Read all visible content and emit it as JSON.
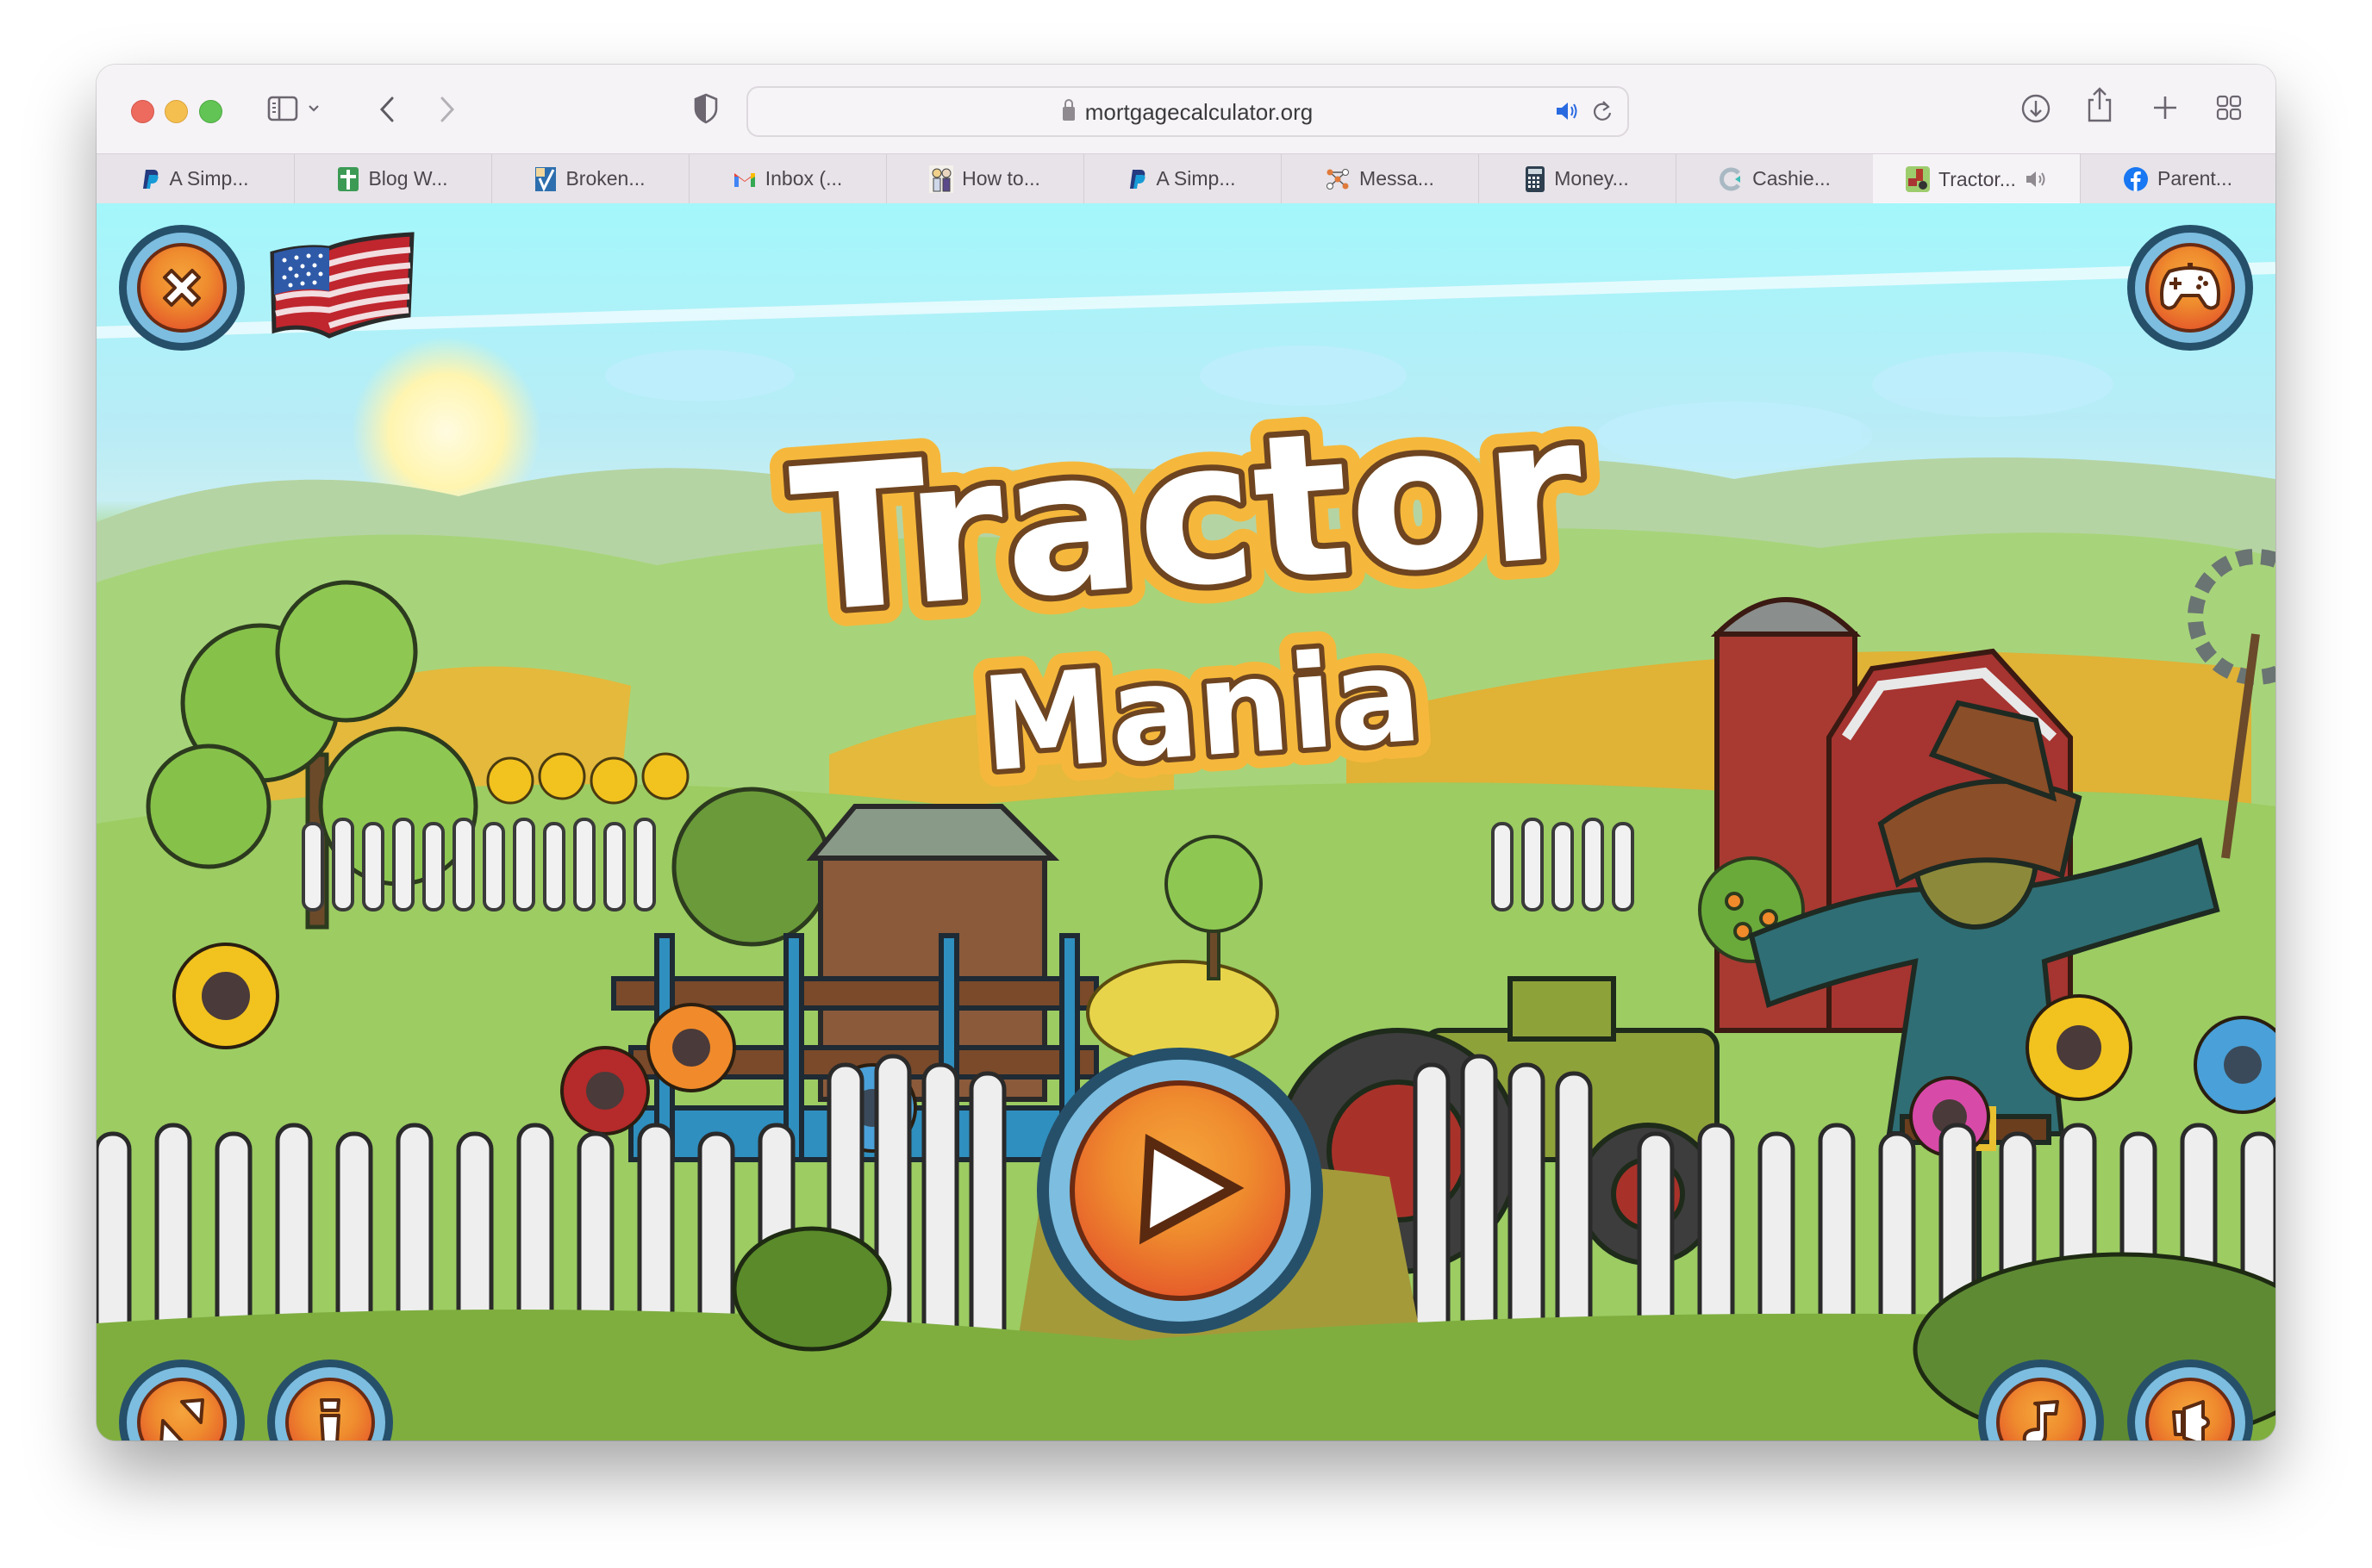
{
  "browser": {
    "url": "mortgagecalculator.org",
    "toolbar_icons": [
      "sidebar-icon",
      "chevron-down-icon",
      "back-icon",
      "forward-icon",
      "shield-icon",
      "audio-playing-icon",
      "reload-icon",
      "download-icon",
      "share-icon",
      "new-tab-icon",
      "tab-overview-icon"
    ],
    "tabs": [
      {
        "label": "A Simp...",
        "icon": "paypal-icon",
        "active": false
      },
      {
        "label": "Blog W...",
        "icon": "green-cross-icon",
        "active": false
      },
      {
        "label": "Broken...",
        "icon": "checkmark-logo-icon",
        "active": false
      },
      {
        "label": "Inbox (...",
        "icon": "gmail-icon",
        "active": false
      },
      {
        "label": "How to...",
        "icon": "cartoon-couple-icon",
        "active": false
      },
      {
        "label": "A Simp...",
        "icon": "paypal-icon",
        "active": false
      },
      {
        "label": "Messa...",
        "icon": "network-icon",
        "active": false
      },
      {
        "label": "Money...",
        "icon": "calculator-icon",
        "active": false
      },
      {
        "label": "Cashie...",
        "icon": "cashier-c-icon",
        "active": false
      },
      {
        "label": "Tractor...",
        "icon": "tractor-game-icon",
        "active": true,
        "audio": true
      },
      {
        "label": "Parent...",
        "icon": "facebook-icon",
        "active": false
      }
    ]
  },
  "game": {
    "title_line1": "Tractor",
    "title_line2": "Mania",
    "buttons": {
      "close": "close-icon",
      "language": "us-flag-icon",
      "more_games": "gamepad-icon",
      "play": "play-icon",
      "fullscreen": "fullscreen-icon",
      "info": "info-icon",
      "music": "music-note-icon",
      "sound": "speaker-icon"
    },
    "colors": {
      "button_orange": "#ef8c2e",
      "button_ring": "#7cbde0",
      "title_fill": "#ffffff",
      "title_outline": "#6e4520",
      "title_glow": "#f5b83c",
      "sky": "#a3f7fb",
      "grass": "#8fc05a"
    }
  }
}
